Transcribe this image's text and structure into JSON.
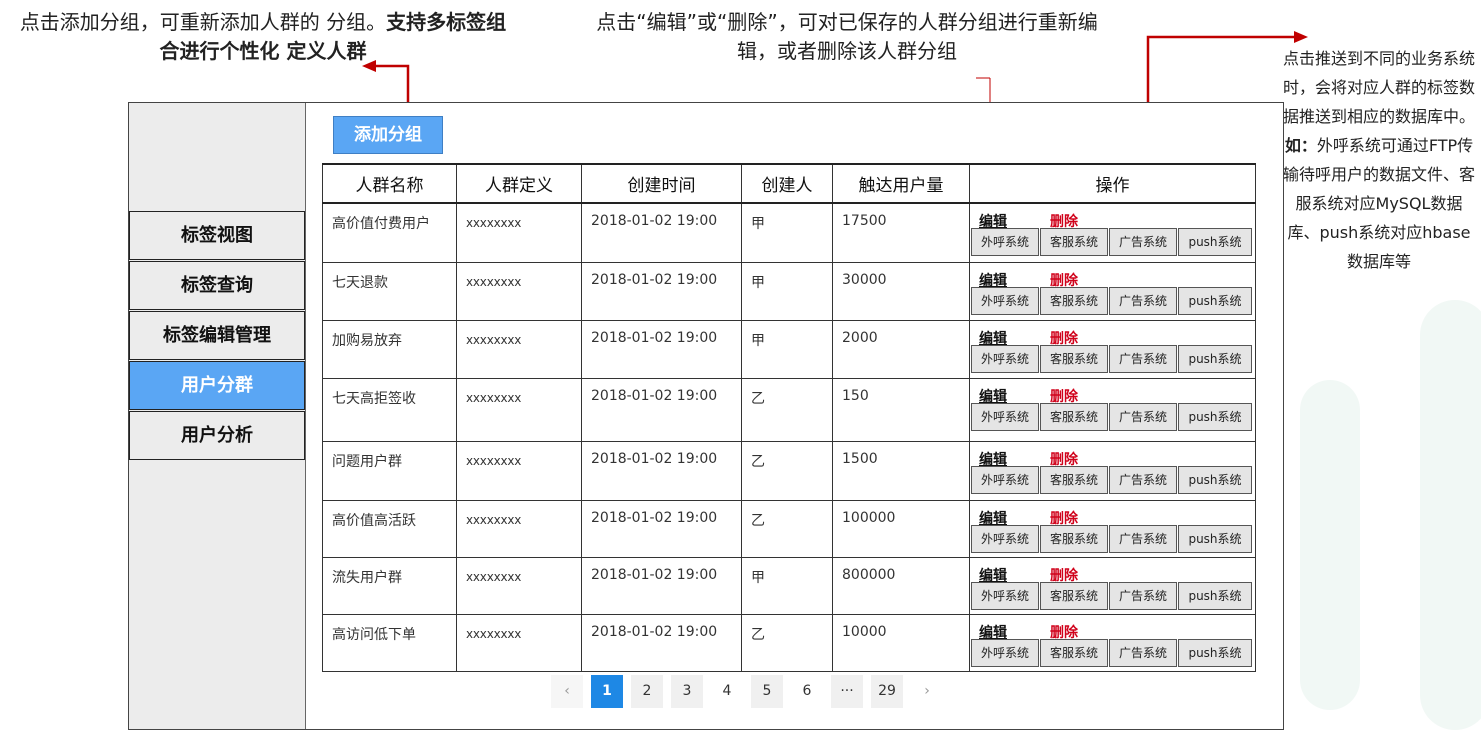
{
  "notes": {
    "left": {
      "normal": "点击添加分组，可重新添加人群的 分组。",
      "bold": "支持多标签组合进行个性化 定义人群"
    },
    "middle": "点击“编辑”或“删除”，可对已保存的人群分组进行重新编辑，或者删除该人群分组",
    "right": {
      "part1": "点击推送到不同的业务系统时，会将对应人群的标签数据推送到相应的数据库中。",
      "bold": "如：",
      "part2": "外呼系统可通过FTP传输待呼用户的数据文件、客服系统对应MySQL数据库、push系统对应hbase数据库等"
    }
  },
  "sidebar": {
    "items": [
      {
        "label": "标签视图",
        "active": false
      },
      {
        "label": "标签查询",
        "active": false
      },
      {
        "label": "标签编辑管理",
        "active": false
      },
      {
        "label": "用户分群",
        "active": true
      },
      {
        "label": "用户分析",
        "active": false
      }
    ]
  },
  "toolbar": {
    "add_group_label": "添加分组"
  },
  "table": {
    "headers": [
      "人群名称",
      "人群定义",
      "创建时间",
      "创建人",
      "触达用户量",
      "操作"
    ],
    "edit_label": "编辑",
    "delete_label": "删除",
    "push_buttons": [
      "外呼系统",
      "客服系统",
      "广告系统",
      "push系统"
    ],
    "rows": [
      {
        "name": "高价值付费用户",
        "definition": "xxxxxxxx",
        "created": "2018-01-02 19:00",
        "creator": "甲",
        "reach": "17500"
      },
      {
        "name": "七天退款",
        "definition": "xxxxxxxx",
        "created": "2018-01-02 19:00",
        "creator": "甲",
        "reach": "30000"
      },
      {
        "name": "加购易放弃",
        "definition": "xxxxxxxx",
        "created": "2018-01-02 19:00",
        "creator": "甲",
        "reach": "2000"
      },
      {
        "name": "七天高拒签收",
        "definition": "xxxxxxxx",
        "created": "2018-01-02 19:00",
        "creator": "乙",
        "reach": "150"
      },
      {
        "name": "问题用户群",
        "definition": "xxxxxxxx",
        "created": "2018-01-02 19:00",
        "creator": "乙",
        "reach": "1500"
      },
      {
        "name": "高价值高活跃",
        "definition": "xxxxxxxx",
        "created": "2018-01-02 19:00",
        "creator": "乙",
        "reach": "100000"
      },
      {
        "name": "流失用户群",
        "definition": "xxxxxxxx",
        "created": "2018-01-02 19:00",
        "creator": "甲",
        "reach": "800000"
      },
      {
        "name": "高访问低下单",
        "definition": "xxxxxxxx",
        "created": "2018-01-02 19:00",
        "creator": "乙",
        "reach": "10000"
      }
    ]
  },
  "pagination": {
    "prev_icon": "chevron-left-icon",
    "next_icon": "chevron-right-icon",
    "prev": "‹",
    "next": "›",
    "pages": [
      "1",
      "2",
      "3",
      "4",
      "5",
      "6",
      "···",
      "29"
    ],
    "current": "1"
  },
  "colors": {
    "accent": "#5aa6f4",
    "pager_active": "#1e88e5",
    "delete": "#d0021b",
    "arrow": "#c00000"
  }
}
